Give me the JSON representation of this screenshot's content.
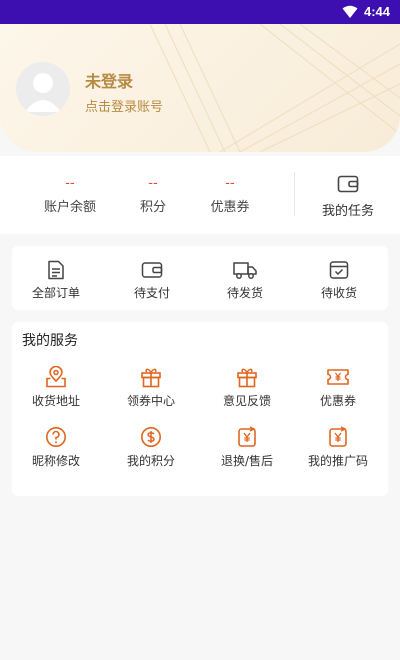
{
  "status_bar": {
    "time": "4:44"
  },
  "profile": {
    "name": "未登录",
    "login_prompt": "点击登录账号"
  },
  "stats": [
    {
      "value": "--",
      "label": "账户余额"
    },
    {
      "value": "--",
      "label": "积分"
    },
    {
      "value": "--",
      "label": "优惠券"
    }
  ],
  "task": {
    "label": "我的任务",
    "icon": "wallet-icon"
  },
  "orders": [
    {
      "label": "全部订单",
      "icon": "document-icon"
    },
    {
      "label": "待支付",
      "icon": "wallet-icon"
    },
    {
      "label": "待发货",
      "icon": "truck-icon"
    },
    {
      "label": "待收货",
      "icon": "inbox-check-icon"
    }
  ],
  "services": {
    "title": "我的服务",
    "items": [
      {
        "label": "收货地址",
        "icon": "map-pin-icon"
      },
      {
        "label": "领券中心",
        "icon": "gift-icon"
      },
      {
        "label": "意见反馈",
        "icon": "gift-icon"
      },
      {
        "label": "优惠券",
        "icon": "coupon-icon"
      },
      {
        "label": "昵称修改",
        "icon": "question-circle-icon"
      },
      {
        "label": "我的积分",
        "icon": "dollar-circle-icon"
      },
      {
        "label": "退换/售后",
        "icon": "yen-refresh-icon"
      },
      {
        "label": "我的推广码",
        "icon": "yen-refresh-icon"
      }
    ]
  },
  "colors": {
    "status_bar": "#3d0fb0",
    "gold": "#b88a44",
    "accent_red": "#e24a2f",
    "icon_orange": "#e0651f"
  }
}
